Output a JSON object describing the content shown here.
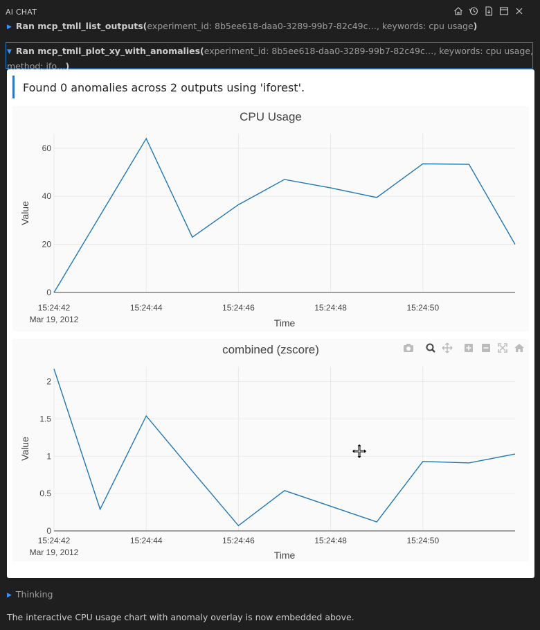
{
  "app": {
    "title": "AI CHAT"
  },
  "toolbar": {
    "icons": [
      "home-icon",
      "history-icon",
      "export-icon",
      "layout-icon",
      "close-icon"
    ]
  },
  "tool_calls": [
    {
      "label": "Ran mcp_tmll_list_outputs(",
      "args": "experiment_id: 8b5ee618-daa0-3289-99b7-82c49c…, keywords: cpu usage",
      "end": ")"
    },
    {
      "label": "Ran mcp_tmll_plot_xy_with_anomalies(",
      "args": "experiment_id: 8b5ee618-daa0-3289-99b7-82c49c…, keywords: cpu usage, method: ifo…",
      "end": ")"
    }
  ],
  "result": {
    "summary": "Found 0 anomalies across 2 outputs using 'iforest'."
  },
  "modebar": [
    "camera-icon",
    "zoom-icon",
    "pan-icon",
    "zoom-in-icon",
    "zoom-out-icon",
    "autoscale-icon",
    "reset-icon"
  ],
  "chart_data": [
    {
      "type": "line",
      "title": "CPU Usage",
      "xlabel": "Time",
      "ylabel": "Value",
      "x": [
        "15:24:42",
        "15:24:43",
        "15:24:44",
        "15:24:45",
        "15:24:46",
        "15:24:47",
        "15:24:48",
        "15:24:49",
        "15:24:50",
        "15:24:51",
        "15:24:52"
      ],
      "x_ticks": [
        "15:24:42",
        "15:24:44",
        "15:24:46",
        "15:24:48",
        "15:24:50"
      ],
      "x_date_label": "Mar 19, 2012",
      "y_ticks": [
        "0",
        "20",
        "40",
        "60"
      ],
      "ylim": [
        0,
        66
      ],
      "series": [
        {
          "values": [
            0,
            32,
            64,
            23,
            36.5,
            47,
            43.5,
            39.5,
            53.5,
            53.3,
            20
          ],
          "color": "#1f77b4"
        }
      ]
    },
    {
      "type": "line",
      "title": "combined (zscore)",
      "xlabel": "Time",
      "ylabel": "Value",
      "x": [
        "15:24:42",
        "15:24:43",
        "15:24:44",
        "15:24:45",
        "15:24:46",
        "15:24:47",
        "15:24:48",
        "15:24:49",
        "15:24:50",
        "15:24:51",
        "15:24:52"
      ],
      "x_ticks": [
        "15:24:42",
        "15:24:44",
        "15:24:46",
        "15:24:48",
        "15:24:50"
      ],
      "x_date_label": "Mar 19, 2012",
      "y_ticks": [
        "0",
        "0.5",
        "1",
        "1.5",
        "2"
      ],
      "ylim": [
        0,
        2.2
      ],
      "series": [
        {
          "values": [
            2.17,
            0.29,
            1.54,
            0.8,
            0.07,
            0.54,
            0.33,
            0.12,
            0.93,
            0.91,
            1.03
          ],
          "color": "#1f77b4"
        }
      ]
    }
  ],
  "thinking": {
    "label": "Thinking"
  },
  "final_message": "The interactive CPU usage chart with anomaly overlay is now embedded above."
}
